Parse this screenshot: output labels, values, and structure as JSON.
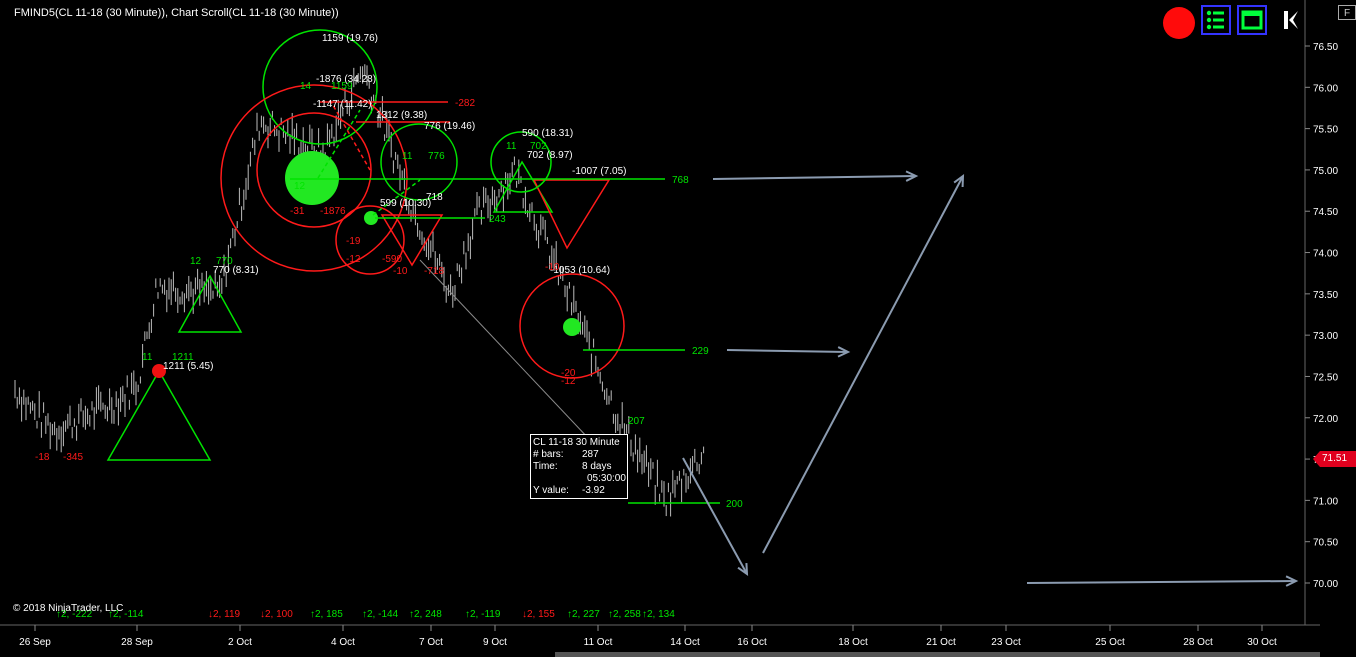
{
  "header": {
    "title": "FMIND5(CL 11-18 (30 Minute)), Chart Scroll(CL 11-18 (30 Minute))"
  },
  "copyright": "© 2018 NinjaTrader, LLC",
  "toolbar": {
    "record_icon": "record-icon",
    "list_icon": "list-icon",
    "window_icon": "window-icon",
    "back_icon": "skip-back-icon"
  },
  "corner_label": "F",
  "last_price": "71.51",
  "tooltip": {
    "title": "CL 11-18 30 Minute",
    "bars_label": "# bars:",
    "bars_value": "287",
    "time_label": "Time:",
    "time_value": "8 days",
    "time_value2": "05:30:00",
    "y_label": "Y value:",
    "y_value": "-3.92"
  },
  "colors": {
    "background": "#000000",
    "price_bars": "#bcbcbc",
    "bullish": "#00e400",
    "bearish": "#ff1a1a",
    "projection_arrows": "#8b9bb0",
    "axis_text": "#ffffff",
    "last_price_tag": "#e0001e"
  },
  "chart_data": {
    "type": "bar",
    "instrument": "CL 11-18",
    "interval": "30 Minute",
    "ylim": [
      69.7,
      76.85
    ],
    "y_ticks": [
      70.0,
      70.5,
      71.0,
      71.5,
      72.0,
      72.5,
      73.0,
      73.5,
      74.0,
      74.5,
      75.0,
      75.5,
      76.0,
      76.5
    ],
    "x_ticks": [
      "26 Sep",
      "28 Sep",
      "2 Oct",
      "4 Oct",
      "7 Oct",
      "9 Oct",
      "11 Oct",
      "14 Oct",
      "16 Oct",
      "18 Oct",
      "21 Oct",
      "23 Oct",
      "25 Oct",
      "28 Oct",
      "30 Oct"
    ],
    "price_path": [
      {
        "x": "26 Sep",
        "y": 72.35
      },
      {
        "x": "26 Sep",
        "y": 72.05
      },
      {
        "x": "26 Sep",
        "y": 71.85
      },
      {
        "x": "28 Sep",
        "y": 72.2
      },
      {
        "x": "28 Sep",
        "y": 72.4
      },
      {
        "x": "28 Sep",
        "y": 73.6
      },
      {
        "x": "2 Oct",
        "y": 73.5
      },
      {
        "x": "2 Oct",
        "y": 75.6
      },
      {
        "x": "4 Oct",
        "y": 75.2
      },
      {
        "x": "4 Oct",
        "y": 76.25
      },
      {
        "x": "7 Oct",
        "y": 74.6
      },
      {
        "x": "7 Oct",
        "y": 73.5
      },
      {
        "x": "9 Oct",
        "y": 74.4
      },
      {
        "x": "9 Oct",
        "y": 75.0
      },
      {
        "x": "11 Oct",
        "y": 73.2
      },
      {
        "x": "11 Oct",
        "y": 72.0
      },
      {
        "x": "14 Oct",
        "y": 71.0
      },
      {
        "x": "14 Oct",
        "y": 71.6
      }
    ],
    "last_price": 71.51,
    "triangles": [
      {
        "label_left": "11",
        "label_right": "1211",
        "value_label": "1211 (5.45)",
        "color": "green"
      },
      {
        "label_left": "12",
        "label_right": "770",
        "value_label": "770 (8.31)",
        "color": "green"
      },
      {
        "label_left": "11",
        "label_right": "702",
        "value_label": "702 (8.97)",
        "color": "green"
      },
      {
        "label_left": "",
        "label_right": "",
        "value_label": "-1007 (7.05)",
        "color": "red"
      }
    ],
    "level_lines": [
      {
        "value": "768",
        "color": "green"
      },
      {
        "value": "243",
        "color": "green"
      },
      {
        "value": "229",
        "color": "green"
      },
      {
        "value": "200",
        "color": "green"
      },
      {
        "value": "-282",
        "color": "red"
      }
    ],
    "annotations": [
      "1159 (19.76)",
      "-1876 (34.28)",
      "-1147 (11.42)",
      "1312 (9.38)",
      "776 (19.46)",
      "590 (18.31)",
      "-1053 (10.64)",
      "599 (10.30)",
      "718",
      "-18",
      "-345",
      "-31",
      "-1876",
      "-19",
      "-12",
      "-590",
      "-10",
      "-718",
      "-10",
      "-20",
      "-12",
      "14",
      "1159",
      "12",
      "11",
      "776",
      "207"
    ],
    "footer_labels": [
      "2, -222",
      "2, -114",
      "2, 119",
      "2, 100",
      "2, 185",
      "2, -144",
      "2, 248",
      "2, -119",
      "2, 155",
      "2, 227",
      "2, 258",
      "2, 134"
    ]
  }
}
